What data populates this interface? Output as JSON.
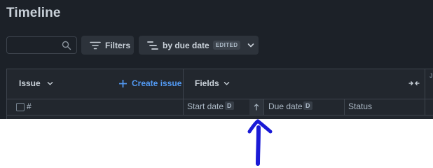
{
  "page": {
    "title": "Timeline"
  },
  "search": {
    "value": "",
    "placeholder": ""
  },
  "toolbar": {
    "filters_label": "Filters",
    "sort_label": "by due date",
    "sort_badge": "EDITED"
  },
  "grid": {
    "issue_header": "Issue",
    "create_issue": "Create issue",
    "fields_header": "Fields",
    "month_label": "JU",
    "columns": {
      "hash": "#",
      "start_date": "Start date",
      "start_date_badge": "D",
      "due_date": "Due date",
      "due_date_badge": "D",
      "status": "Status"
    }
  },
  "icons": {
    "search": "search-icon",
    "filters": "filter-icon",
    "sort": "sort-icon",
    "chevron": "chevron-down-icon",
    "plus": "plus-icon",
    "collapse": "collapse-columns-icon",
    "sort_up": "arrow-up-icon"
  },
  "annotation": {
    "color": "#1a1ad6"
  },
  "colors": {
    "background": "#1c2128",
    "panel": "#22272e",
    "button": "#2d333b",
    "text": "#c9d1d9",
    "link": "#539bf5",
    "border": "#3d444d"
  }
}
